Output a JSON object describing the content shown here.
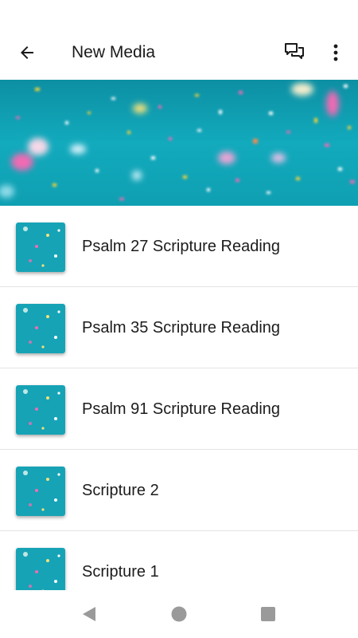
{
  "header": {
    "title": "New Media",
    "back_icon": "arrow-back-icon",
    "chat_icon": "forum-icon",
    "more_icon": "more-vert-icon"
  },
  "hero": {
    "image": "confetti-teal-banner",
    "colors": [
      "#0fa6b8",
      "#f075b8",
      "#ffffff",
      "#f2d23a"
    ]
  },
  "media_list": [
    {
      "label": "Psalm 27 Scripture Reading"
    },
    {
      "label": "Psalm 35 Scripture Reading"
    },
    {
      "label": "Psalm 91 Scripture Reading"
    },
    {
      "label": "Scripture 2"
    },
    {
      "label": "Scripture 1"
    }
  ],
  "nav": {
    "back_icon": "nav-back-triangle-icon",
    "home_icon": "nav-home-circle-icon",
    "recents_icon": "nav-recents-square-icon"
  }
}
